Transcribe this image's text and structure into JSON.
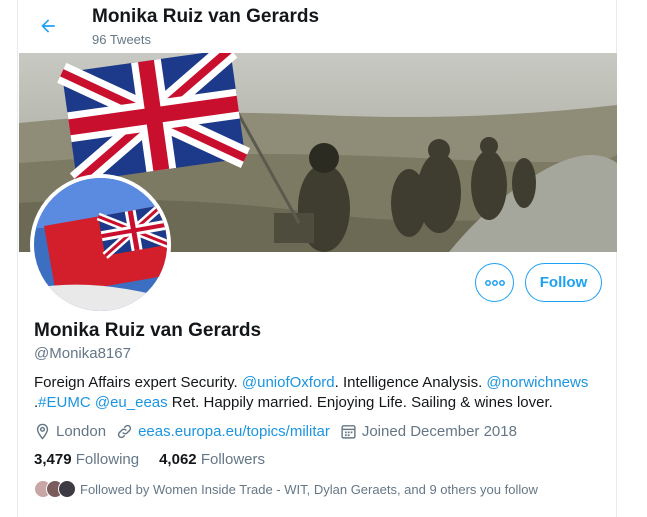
{
  "header": {
    "back_icon": "arrow-left-icon",
    "name": "Monika Ruiz van Gerards",
    "tweet_count": "96 Tweets"
  },
  "profile": {
    "display_name": "Monika Ruiz van Gerards",
    "handle": "@Monika8167",
    "bio": {
      "t1": "Foreign Affairs expert Security. ",
      "link1": "@uniofOxford",
      "t2": ". Intelligence Analysis. ",
      "link2": "@norwichnews",
      "t3": " .",
      "link3": "#EUMC",
      "t4": " ",
      "link4": "@eu_eeas",
      "t5": " Ret. Happily married. Enjoying Life. Sailing & wines lover."
    },
    "location": "London",
    "website": "eeas.europa.eu/topics/militar",
    "joined": "Joined December 2018",
    "following_count": "3,479",
    "following_label": "Following",
    "followers_count": "4,062",
    "followers_label": "Followers",
    "followed_by": "Followed by Women Inside Trade - WIT, Dylan Geraets, and 9 others you follow"
  },
  "buttons": {
    "follow": "Follow",
    "more_icon": "more-horizontal-icon"
  },
  "colors": {
    "accent": "#1da1f2",
    "link": "#1b95e0",
    "secondary_text": "#657786",
    "primary_text": "#14171a"
  }
}
